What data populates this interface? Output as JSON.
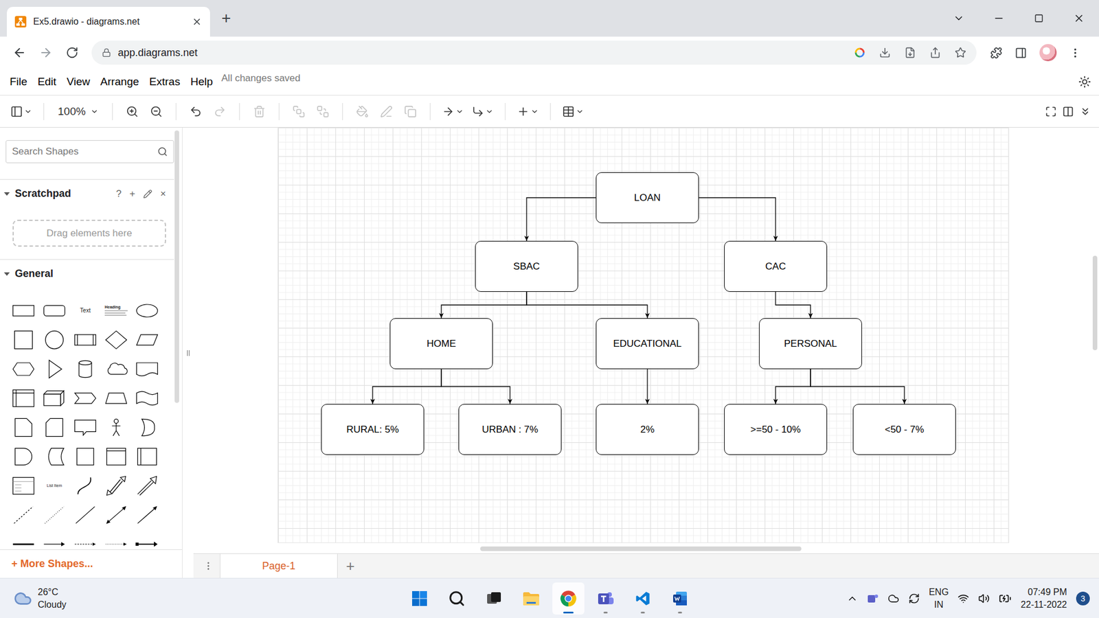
{
  "browser": {
    "tab_title": "Ex5.drawio - diagrams.net",
    "new_tab": "+",
    "url": "app.diagrams.net"
  },
  "menu": {
    "items": [
      "File",
      "Edit",
      "View",
      "Arrange",
      "Extras",
      "Help"
    ],
    "status": "All changes saved"
  },
  "toolbar": {
    "zoom": "100%",
    "buttons": [
      {
        "disabled": false
      },
      {
        "disabled": false
      },
      {
        "disabled": false
      },
      {
        "disabled": false
      },
      {
        "disabled": true
      },
      {
        "disabled": true
      },
      {
        "disabled": true
      },
      {
        "disabled": true
      },
      {
        "disabled": true
      },
      {
        "disabled": true
      },
      {
        "disabled": true
      },
      {
        "disabled": false
      },
      {
        "disabled": false
      },
      {
        "disabled": false
      },
      {
        "disabled": false
      }
    ]
  },
  "sidebar": {
    "search_placeholder": "Search Shapes",
    "scratchpad": {
      "title": "Scratchpad",
      "expanded": true,
      "actions": [
        "?",
        "+",
        "×"
      ],
      "drop_hint": "Drag elements here"
    },
    "general": {
      "title": "General",
      "expanded": true,
      "shape_texts": [
        "Text",
        "Heading",
        "List Item"
      ]
    },
    "more_shapes": "+ More Shapes..."
  },
  "diagram": {
    "label": "LOAN",
    "children": [
      {
        "label": "SBAC",
        "children": [
          {
            "label": "HOME",
            "children": [
              {
                "label": "RURAL: 5%",
                "children": []
              },
              {
                "label": "URBAN : 7%",
                "children": []
              }
            ]
          },
          {
            "label": "EDUCATIONAL",
            "children": [
              {
                "label": "2%",
                "children": []
              }
            ]
          }
        ]
      },
      {
        "label": "CAC",
        "children": [
          {
            "label": "PERSONAL",
            "children": [
              {
                "label": ">=50 - 10%",
                "children": []
              },
              {
                "label": "<50 - 7%",
                "children": []
              }
            ]
          }
        ]
      }
    ]
  },
  "pages": {
    "tabs": [
      {
        "label": "Page-1",
        "selected": true
      }
    ],
    "add": "+"
  },
  "taskbar": {
    "weather": {
      "temp": "26°C",
      "condition": "Cloudy"
    },
    "apps": [
      {
        "running": false,
        "active": false
      },
      {
        "running": false,
        "active": false
      },
      {
        "running": false,
        "active": false
      },
      {
        "running": false,
        "active": false
      },
      {
        "running": true,
        "active": true
      },
      {
        "running": true,
        "active": false
      },
      {
        "running": true,
        "active": false
      },
      {
        "running": true,
        "active": false
      }
    ],
    "language": [
      "ENG",
      "IN"
    ],
    "time": "07:49 PM",
    "date": "22-11-2022",
    "notifications": "3"
  }
}
